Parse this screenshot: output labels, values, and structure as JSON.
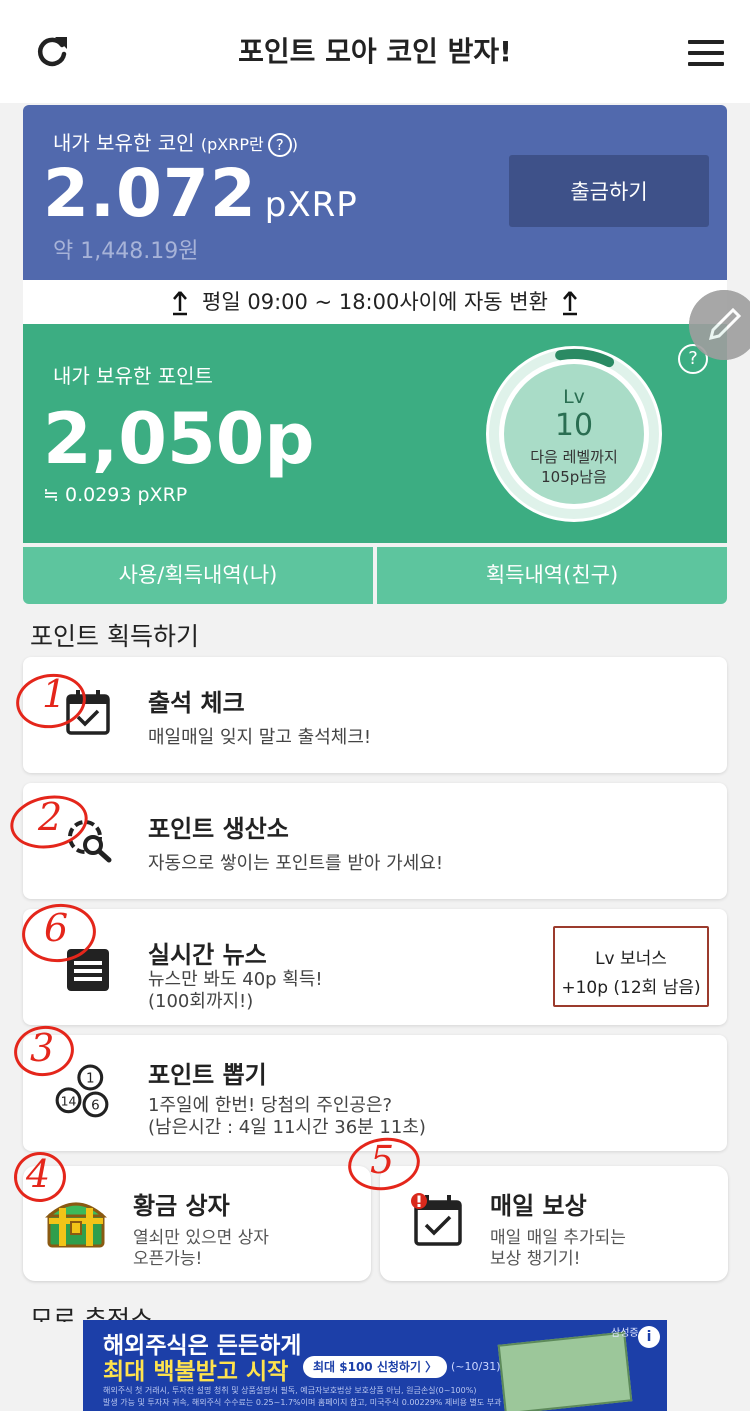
{
  "header": {
    "title": "포인트 모아 코인 받자!"
  },
  "coin": {
    "label": "내가 보유한 코인",
    "sub_label": "(pXRP란",
    "sub_label_end": ")",
    "help": "?",
    "amount": "2.072",
    "unit": "pXRP",
    "krw": "약 1,448.19원",
    "withdraw_label": "출금하기"
  },
  "notice": {
    "text": "평일 09:00 ~ 18:00사이에 자동 변환"
  },
  "points": {
    "label": "내가 보유한 포인트",
    "amount": "2,050p",
    "converted": "≒ 0.0293 pXRP",
    "help": "?",
    "level_label": "Lv",
    "level": "10",
    "next_level_line1": "다음 레벨까지",
    "next_level_line2": "105p남음",
    "level_progress": 0.1
  },
  "history": {
    "mine_label": "사용/획득내역(나)",
    "friend_label": "획득내역(친구)"
  },
  "earn_section": {
    "title": "포인트 획득하기",
    "items": [
      {
        "title": "출석 체크",
        "desc1": "매일매일 잊지 말고 출석체크!",
        "icon": "calendar-check-icon"
      },
      {
        "title": "포인트 생산소",
        "desc1": "자동으로 쌓이는 포인트를 받아 가세요!",
        "icon": "search-gear-icon"
      },
      {
        "title": "실시간 뉴스",
        "desc1": "뉴스만 봐도 40p 획득!",
        "desc2": "(100회까지!)",
        "icon": "news-icon",
        "bonus_line1": "Lv 보너스",
        "bonus_line2": "+10p (12회 남음)"
      },
      {
        "title": "포인트 뽑기",
        "desc1": "1주일에 한번! 당첨의 주인공은?",
        "desc2": "(남은시간 : 4일 11시간 36분 11초)",
        "icon": "lottery-balls-icon"
      }
    ],
    "half_items": [
      {
        "title": "황금 상자",
        "desc1": "열쇠만 있으면 상자",
        "desc2": "오픈가능!",
        "icon": "treasure-chest-icon"
      },
      {
        "title": "매일 보상",
        "desc1": "매일 매일 추가되는",
        "desc2": "보상 챙기기!",
        "icon": "calendar-alert-icon"
      }
    ]
  },
  "annotations": [
    "1",
    "2",
    "6",
    "3",
    "4",
    "5"
  ],
  "next_section_partial": "모로 추전소",
  "ad": {
    "line1": "해외주식은 든든하게",
    "line2": "최대 백불받고 시작",
    "button": "최대 $100 신청하기 〉",
    "period": "(~10/31)",
    "brand": "삼성증",
    "info": "i",
    "fine1": "해외주식 첫 거래시, 투자전 설명 청취 및 상품설명서 필독, 예금자보호법상 보호상품 아님, 원금손실(0~100%)",
    "fine2": "발생 가능 및 투자자 귀속, 해외주식 수수료는 0.25~1.7%이며 홈페이지 참고, 미국주식 0.00229% 제비용 별도 부과"
  },
  "colors": {
    "coin_bg": "#5169ad",
    "point_bg": "#3cad82",
    "history_bg": "#5dc59e",
    "annotation": "#e4261b"
  }
}
